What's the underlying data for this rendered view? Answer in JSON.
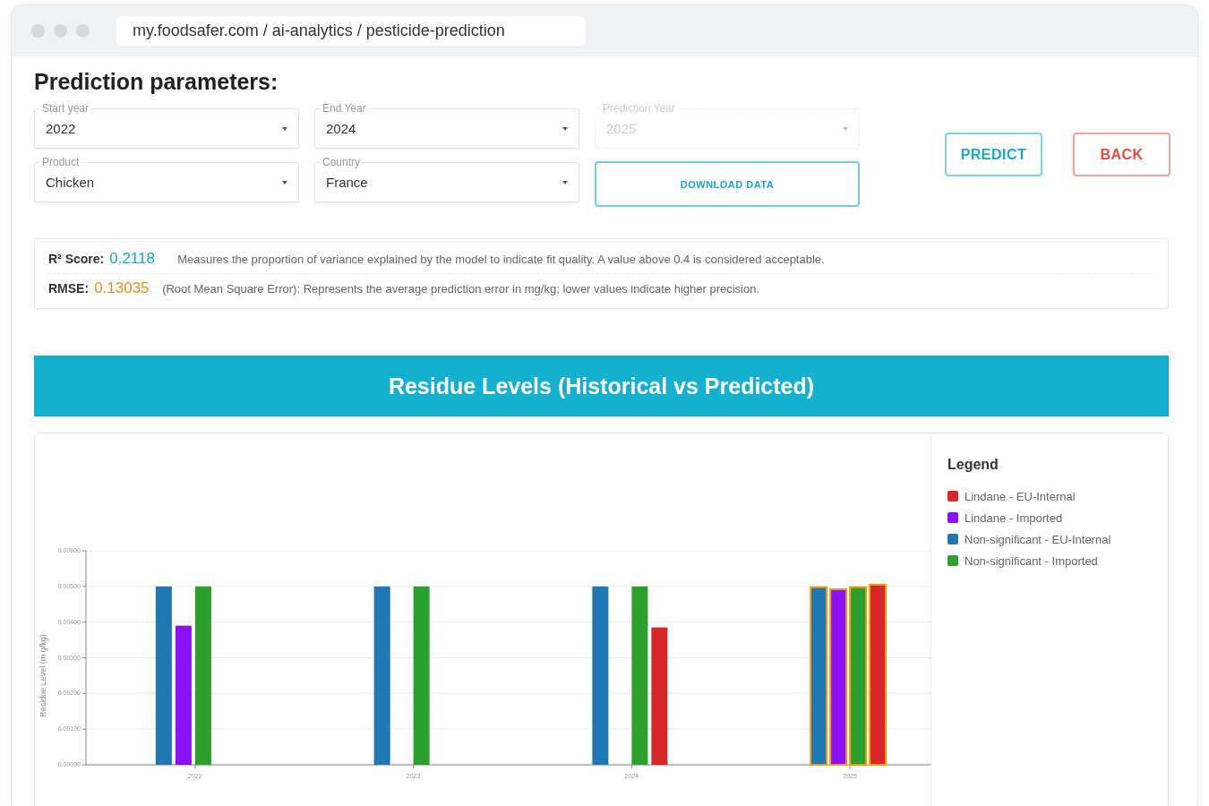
{
  "browser": {
    "url": "my.foodsafer.com / ai-analytics / pesticide-prediction"
  },
  "heading": "Prediction parameters:",
  "fields": [
    {
      "label": "Start year",
      "value": "2022",
      "disabled": false
    },
    {
      "label": "End Year",
      "value": "2024",
      "disabled": false
    },
    {
      "label": "Prediction Year",
      "value": "2025",
      "disabled": true
    },
    {
      "label": "Product",
      "value": "Chicken",
      "disabled": false
    },
    {
      "label": "Country",
      "value": "France",
      "disabled": false
    }
  ],
  "download_button": "DOWNLOAD DATA",
  "buttons": [
    {
      "label": "PREDICT",
      "kind": "primary"
    },
    {
      "label": "BACK",
      "kind": "danger"
    }
  ],
  "metrics": [
    {
      "name": "R² Score:",
      "value": "0.2118",
      "color": "#1aa8c8",
      "description": "Measures the proportion of variance explained by the model to indicate fit quality. A value above 0.4 is considered acceptable."
    },
    {
      "name": "RMSE:",
      "value": "0.13035",
      "color": "#f28c1c",
      "description": "(Root Mean Square Error): Represents the average prediction error in mg/kg; lower values indicate higher precision."
    }
  ],
  "chart": {
    "title": "Residue Levels (Historical vs Predicted)",
    "legend_title": "Legend",
    "series_bar_positions": [
      {
        "kind": "fourth"
      },
      {
        "kind": "second"
      },
      {
        "kind": "first"
      },
      {
        "kind": "third"
      }
    ],
    "periods": [
      {
        "predicted": false
      },
      {
        "predicted": false
      },
      {
        "predicted": false
      },
      {
        "predicted": true
      }
    ],
    "chart_data": {
      "type": "bar",
      "grid": true,
      "ylabel": "Residue Level (m g/kg)",
      "categories": [
        "2022",
        "2023",
        "2024",
        "2025"
      ],
      "series": [
        {
          "name": "Lindane - EU-Internal",
          "color": "#d62728",
          "values": [
            null,
            null,
            0.00385,
            0.00505
          ]
        },
        {
          "name": "Lindane - Imported",
          "color": "#8b10f5",
          "values": [
            0.0039,
            null,
            null,
            0.00492
          ]
        },
        {
          "name": "Non-significant - EU-Internal",
          "color": "#1f77b4",
          "values": [
            0.005,
            0.005,
            0.005,
            0.00498
          ]
        },
        {
          "name": "Non-significant - Imported",
          "color": "#2ca02c",
          "values": [
            0.005,
            0.005,
            0.005,
            0.00498
          ]
        }
      ],
      "ylim": [
        0,
        0.006
      ],
      "yticks": [
        {
          "value": 0,
          "label": "0.00000"
        },
        {
          "value": 0.001,
          "label": "0.00100"
        },
        {
          "value": 0.002,
          "label": "0.00200"
        },
        {
          "value": 0.003,
          "label": "0.00300"
        },
        {
          "value": 0.004,
          "label": "0.00400"
        },
        {
          "value": 0.005,
          "label": "0.00500"
        },
        {
          "value": 0.006,
          "label": "0.00600"
        }
      ]
    }
  }
}
